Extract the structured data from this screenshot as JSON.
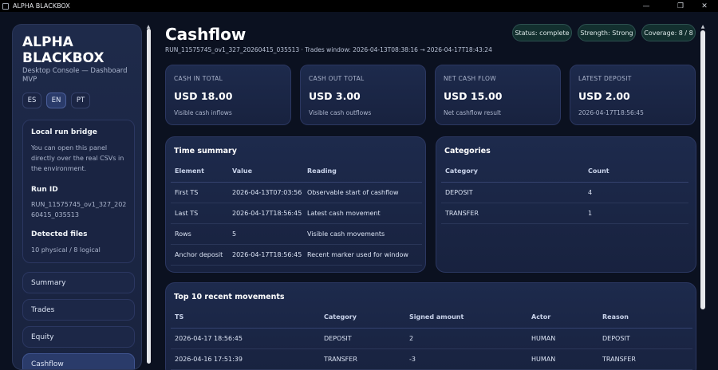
{
  "window": {
    "title": "ALPHA BLACKBOX"
  },
  "sidebar": {
    "brand": "ALPHA BLACKBOX",
    "subtitle": "Desktop Console — Dashboard MVP",
    "languages": [
      "ES",
      "EN",
      "PT"
    ],
    "active_language": "EN",
    "bridge_title": "Local run bridge",
    "bridge_text": "You can open this panel directly over the real CSVs in the environment.",
    "run_id_label": "Run ID",
    "run_id_value": "RUN_11575745_ov1_327_20260415_035513",
    "files_label": "Detected files",
    "files_value": "10 physical / 8 logical",
    "nav": [
      "Summary",
      "Trades",
      "Equity",
      "Cashflow"
    ],
    "active_nav": "Cashflow"
  },
  "header": {
    "title": "Cashflow",
    "run_line": "RUN_11575745_ov1_327_20260415_035513 · Trades window: 2026-04-13T08:38:16 → 2026-04-17T18:43:24",
    "pills": [
      "Status: complete",
      "Strength: Strong",
      "Coverage: 8 / 8"
    ]
  },
  "kpis": [
    {
      "label": "Cash in total",
      "value": "USD 18.00",
      "sub": "Visible cash inflows"
    },
    {
      "label": "Cash out total",
      "value": "USD 3.00",
      "sub": "Visible cash outflows"
    },
    {
      "label": "Net cash flow",
      "value": "USD 15.00",
      "sub": "Net cashflow result"
    },
    {
      "label": "Latest deposit",
      "value": "USD 2.00",
      "sub": "2026-04-17T18:56:45"
    }
  ],
  "time_summary": {
    "title": "Time summary",
    "columns": [
      "Element",
      "Value",
      "Reading"
    ],
    "rows": [
      [
        "First TS",
        "2026-04-13T07:03:56",
        "Observable start of cashflow"
      ],
      [
        "Last TS",
        "2026-04-17T18:56:45",
        "Latest cash movement"
      ],
      [
        "Rows",
        "5",
        "Visible cash movements"
      ],
      [
        "Anchor deposit",
        "2026-04-17T18:56:45",
        "Recent marker used for window"
      ]
    ]
  },
  "categories": {
    "title": "Categories",
    "columns": [
      "Category",
      "Count"
    ],
    "rows": [
      [
        "DEPOSIT",
        "4"
      ],
      [
        "TRANSFER",
        "1"
      ]
    ]
  },
  "recent": {
    "title": "Top 10 recent movements",
    "columns": [
      "TS",
      "Category",
      "Signed amount",
      "Actor",
      "Reason"
    ],
    "rows": [
      [
        "2026-04-17 18:56:45",
        "DEPOSIT",
        "2",
        "HUMAN",
        "DEPOSIT"
      ],
      [
        "2026-04-16 17:51:39",
        "TRANSFER",
        "-3",
        "HUMAN",
        "TRANSFER"
      ]
    ]
  }
}
